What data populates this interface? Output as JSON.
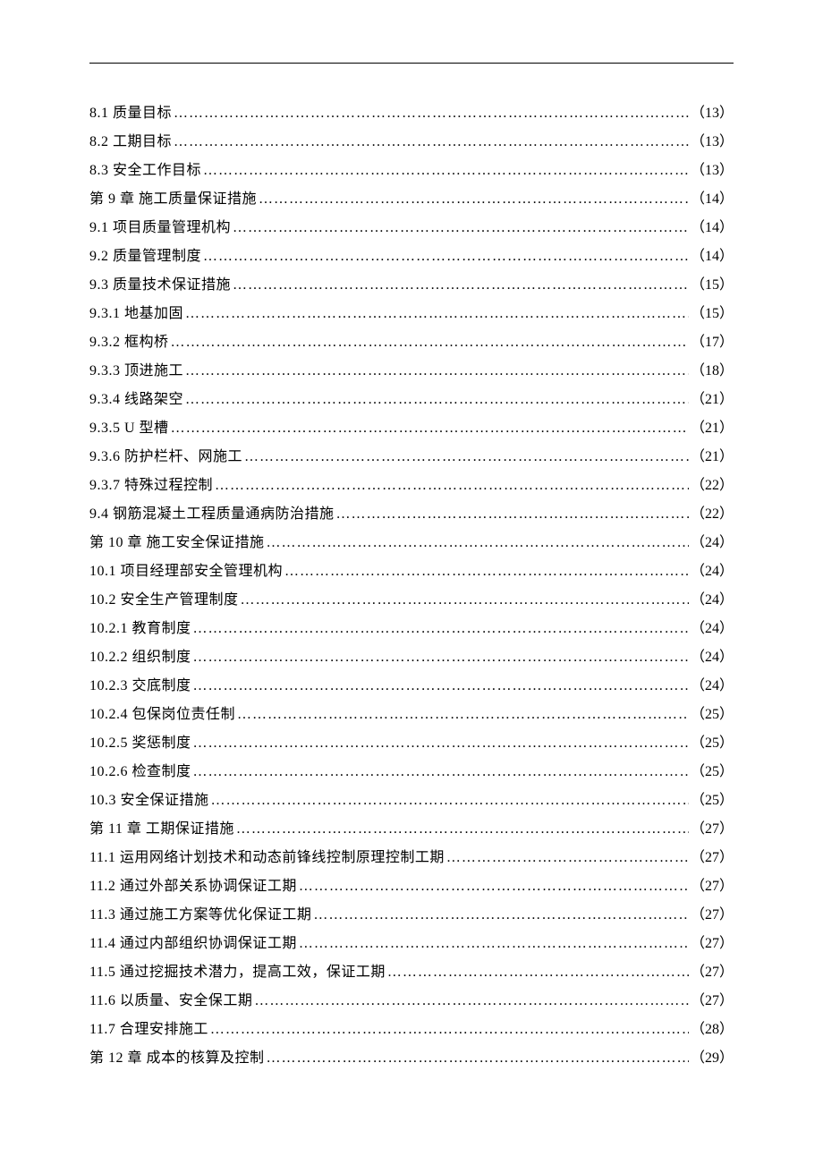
{
  "toc": [
    {
      "label": "8.1 质量目标",
      "page": "（13）"
    },
    {
      "label": "8.2 工期目标",
      "page": "（13）"
    },
    {
      "label": "8.3 安全工作目标",
      "page": "（13）"
    },
    {
      "label": "第 9 章  施工质量保证措施",
      "page": "（14）"
    },
    {
      "label": "9.1 项目质量管理机构",
      "page": "（14）"
    },
    {
      "label": "9.2 质量管理制度",
      "page": "（14）"
    },
    {
      "label": "9.3 质量技术保证措施",
      "page": "（15）"
    },
    {
      "label": "9.3.1 地基加固",
      "page": "（15）"
    },
    {
      "label": "9.3.2 框构桥",
      "page": "（17）"
    },
    {
      "label": "9.3.3 顶进施工",
      "page": "（18）"
    },
    {
      "label": "9.3.4 线路架空",
      "page": "（21）"
    },
    {
      "label": "9.3.5 U 型槽",
      "page": "（21）"
    },
    {
      "label": "9.3.6 防护栏杆、网施工",
      "page": "（21）"
    },
    {
      "label": "9.3.7 特殊过程控制",
      "page": "（22）"
    },
    {
      "label": "9.4 钢筋混凝土工程质量通病防治措施",
      "page": "（22）"
    },
    {
      "label": "第 10 章 施工安全保证措施",
      "page": "（24）"
    },
    {
      "label": "10.1 项目经理部安全管理机构",
      "page": "（24）"
    },
    {
      "label": "10.2 安全生产管理制度",
      "page": "（24）"
    },
    {
      "label": "10.2.1 教育制度",
      "page": "（24）"
    },
    {
      "label": "10.2.2 组织制度",
      "page": "（24）"
    },
    {
      "label": "10.2.3 交底制度",
      "page": "（24）"
    },
    {
      "label": "10.2.4 包保岗位责任制",
      "page": "（25）"
    },
    {
      "label": "10.2.5 奖惩制度",
      "page": "（25）"
    },
    {
      "label": "10.2.6 检查制度",
      "page": "（25）"
    },
    {
      "label": "10.3 安全保证措施",
      "page": "（25）"
    },
    {
      "label": "第 11 章 工期保证措施",
      "page": "（27）"
    },
    {
      "label": "11.1 运用网络计划技术和动态前锋线控制原理控制工期",
      "page": "（27）"
    },
    {
      "label": "11.2 通过外部关系协调保证工期",
      "page": "（27）"
    },
    {
      "label": "11.3 通过施工方案等优化保证工期",
      "page": "（27）"
    },
    {
      "label": "11.4 通过内部组织协调保证工期",
      "page": "（27）"
    },
    {
      "label": "11.5 通过挖掘技术潜力，提高工效，保证工期",
      "page": "（27）"
    },
    {
      "label": "11.6 以质量、安全保工期",
      "page": "（27）"
    },
    {
      "label": "11.7 合理安排施工",
      "page": "（28）"
    },
    {
      "label": "第 12 章  成本的核算及控制",
      "page": "（29）"
    }
  ]
}
